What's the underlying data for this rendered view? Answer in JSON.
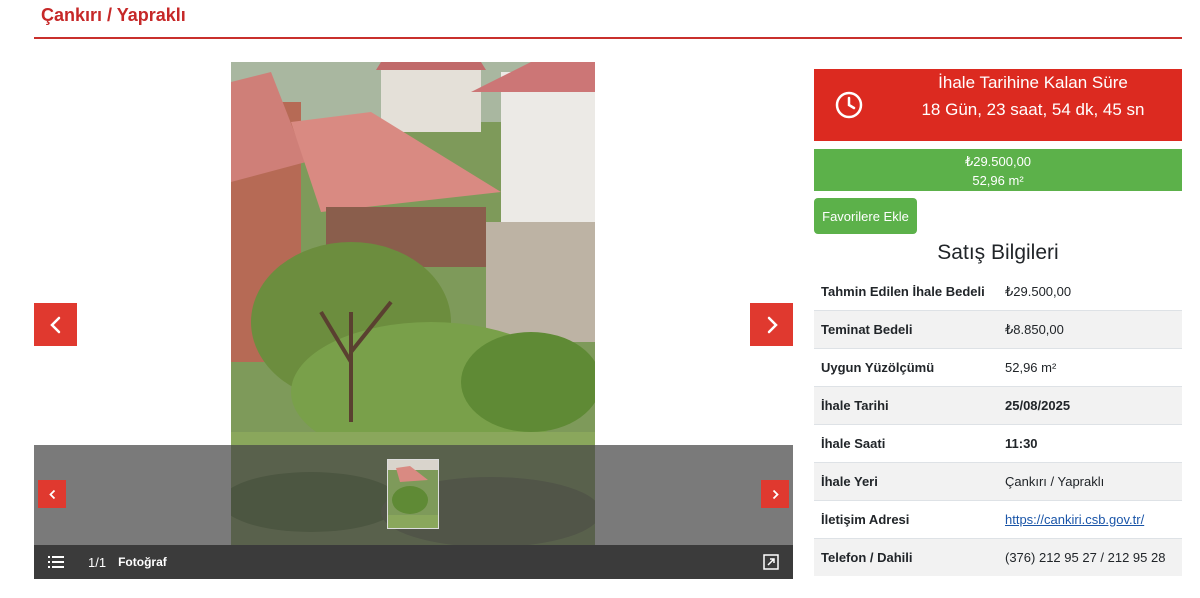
{
  "page": {
    "title": "Çankırı / Yapraklı"
  },
  "gallery": {
    "counter": "1/1",
    "label": "Fotoğraf",
    "prev_icon": "chevron-left-icon",
    "next_icon": "chevron-right-icon",
    "list_icon": "list-icon",
    "expand_icon": "expand-icon"
  },
  "countdown": {
    "title": "İhale Tarihine Kalan Süre",
    "time": "18 Gün, 23 saat, 54 dk, 45 sn",
    "icon": "clock-icon",
    "color": "#dc2a20"
  },
  "price_box": {
    "price": "₺29.500,00",
    "area": "52,96 m²",
    "color": "#5cb14a"
  },
  "favorite_button": {
    "label": "Favorilere Ekle"
  },
  "sales": {
    "title": "Satış Bilgileri",
    "rows": [
      {
        "label": "Tahmin Edilen İhale Bedeli",
        "value": "₺29.500,00"
      },
      {
        "label": "Teminat Bedeli",
        "value": "₺8.850,00"
      },
      {
        "label": "Uygun Yüzölçümü",
        "value": "52,96 m²"
      },
      {
        "label": "İhale Tarihi",
        "value": "25/08/2025"
      },
      {
        "label": "İhale Saati",
        "value": "11:30"
      },
      {
        "label": "İhale Yeri",
        "value": "Çankırı / Yapraklı"
      },
      {
        "label": "İletişim Adresi",
        "value": "https://cankiri.csb.gov.tr/"
      },
      {
        "label": "Telefon / Dahili",
        "value": "(376) 212 95 27 / 212 95 28"
      }
    ]
  }
}
